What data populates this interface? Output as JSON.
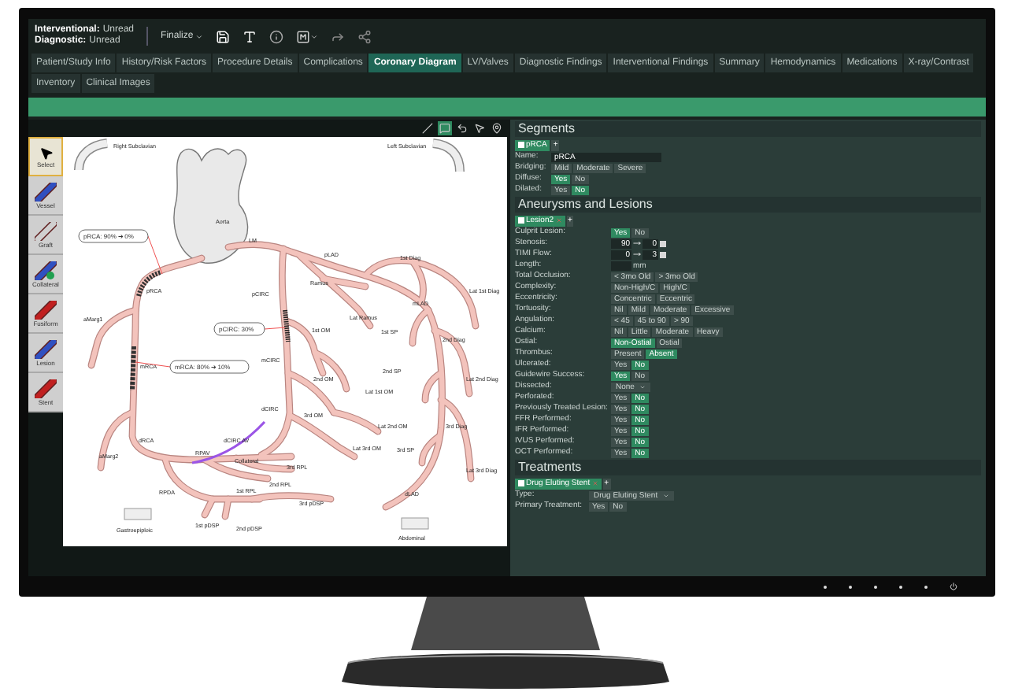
{
  "header": {
    "status": [
      {
        "label": "Interventional:",
        "value": "Unread"
      },
      {
        "label": "Diagnostic:",
        "value": "Unread"
      }
    ],
    "finalize": "Finalize"
  },
  "tabs": [
    {
      "label": "Patient/Study Info",
      "selected": false
    },
    {
      "label": "History/Risk Factors",
      "selected": false
    },
    {
      "label": "Procedure Details",
      "selected": false
    },
    {
      "label": "Complications",
      "selected": false
    },
    {
      "label": "Coronary Diagram",
      "selected": true
    },
    {
      "label": "LV/Valves",
      "selected": false
    },
    {
      "label": "Diagnostic Findings",
      "selected": false
    },
    {
      "label": "Interventional Findings",
      "selected": false
    },
    {
      "label": "Summary",
      "selected": false
    },
    {
      "label": "Hemodynamics",
      "selected": false
    },
    {
      "label": "Medications",
      "selected": false
    },
    {
      "label": "X-ray/Contrast",
      "selected": false
    },
    {
      "label": "Inventory",
      "selected": false
    },
    {
      "label": "Clinical Images",
      "selected": false
    }
  ],
  "diagram": {
    "toolbar": [
      {
        "kind": "line",
        "selected": false
      },
      {
        "kind": "comment",
        "selected": true
      },
      {
        "kind": "undo",
        "selected": false
      },
      {
        "kind": "pointer",
        "selected": false
      },
      {
        "kind": "pin",
        "selected": false
      }
    ],
    "tools": [
      {
        "label": "Select",
        "kind": "select",
        "selected": true
      },
      {
        "label": "Vessel",
        "kind": "vessel",
        "selected": false
      },
      {
        "label": "Graft",
        "kind": "graft",
        "selected": false
      },
      {
        "label": "Collateral",
        "kind": "collateral",
        "selected": false
      },
      {
        "label": "Fusiform",
        "kind": "fusiform",
        "selected": false
      },
      {
        "label": "Lesion",
        "kind": "lesion",
        "selected": false
      },
      {
        "label": "Stent",
        "kind": "stent",
        "selected": false
      }
    ],
    "labels": [
      "Right Subclavian",
      "Left Subclavian",
      "Aorta",
      "LM",
      "pLAD",
      "1st Diag",
      "Lat 1st Diag",
      "Ramus",
      "pCIRC",
      "Lat Ramus",
      "mLAD",
      "1st SP",
      "2nd Diag",
      "pRCA",
      "aMarg1",
      "1st OM",
      "mCIRC",
      "mRCA",
      "2nd OM",
      "2nd SP",
      "Lat 1st OM",
      "Lat 2nd Diag",
      "dCIRC",
      "3rd OM",
      "Lat 2nd OM",
      "3rd Diag",
      "dRCA",
      "Lat 3rd OM",
      "3rd SP",
      "Lat 3rd Diag",
      "aMarg2",
      "RPAV",
      "dCIRC AV",
      "Collateral",
      "3rd RPL",
      "2nd RPL",
      "1st RPL",
      "RPDA",
      "3rd pDSP",
      "1st pDSP",
      "2nd pDSP",
      "dLAD"
    ],
    "callouts": [
      "pRCA: 90% ➔ 0%",
      "pCIRC: 30%",
      "mRCA: 80% ➔ 10%"
    ],
    "landmarks": [
      "Gastroepiploic",
      "Abdominal"
    ]
  },
  "segments": {
    "title": "Segments",
    "chips": [
      {
        "label": "pRCA",
        "selected": true
      }
    ],
    "add": "+",
    "name": {
      "label": "Name:",
      "value": "pRCA"
    },
    "fields": [
      {
        "label": "Bridging:",
        "options": [
          {
            "label": "Mild",
            "selected": false
          },
          {
            "label": "Moderate",
            "selected": false
          },
          {
            "label": "Severe",
            "selected": false
          }
        ]
      },
      {
        "label": "Diffuse:",
        "options": [
          {
            "label": "Yes",
            "selected": true
          },
          {
            "label": "No",
            "selected": false
          }
        ]
      },
      {
        "label": "Dilated:",
        "options": [
          {
            "label": "Yes",
            "selected": false
          },
          {
            "label": "No",
            "selected": true
          }
        ]
      }
    ]
  },
  "lesions": {
    "title": "Aneurysms and Lesions",
    "chips": [
      {
        "label": "Lesion2",
        "selected": true
      }
    ],
    "add": "+",
    "fields": [
      {
        "label": "Culprit Lesion:",
        "kind": "options",
        "options": [
          {
            "label": "Yes",
            "selected": true
          },
          {
            "label": "No",
            "selected": false
          }
        ]
      },
      {
        "label": "Stenosis:",
        "kind": "range",
        "from": "90",
        "to": "0"
      },
      {
        "label": "TIMI Flow:",
        "kind": "range",
        "from": "0",
        "to": "3"
      },
      {
        "label": "Length:",
        "kind": "length",
        "unit": "mm"
      },
      {
        "label": "Total Occlusion:",
        "kind": "options",
        "options": [
          {
            "label": "< 3mo Old",
            "selected": false
          },
          {
            "label": "> 3mo Old",
            "selected": false
          }
        ]
      },
      {
        "label": "Complexity:",
        "kind": "options",
        "options": [
          {
            "label": "Non-High/C",
            "selected": false
          },
          {
            "label": "High/C",
            "selected": false
          }
        ]
      },
      {
        "label": "Eccentricity:",
        "kind": "options",
        "options": [
          {
            "label": "Concentric",
            "selected": false
          },
          {
            "label": "Eccentric",
            "selected": false
          }
        ]
      },
      {
        "label": "Tortuosity:",
        "kind": "options",
        "options": [
          {
            "label": "Nil",
            "selected": false
          },
          {
            "label": "Mild",
            "selected": false
          },
          {
            "label": "Moderate",
            "selected": false
          },
          {
            "label": "Excessive",
            "selected": false
          }
        ]
      },
      {
        "label": "Angulation:",
        "kind": "options",
        "options": [
          {
            "label": "< 45",
            "selected": false
          },
          {
            "label": "45 to 90",
            "selected": false
          },
          {
            "label": "> 90",
            "selected": false
          }
        ]
      },
      {
        "label": "Calcium:",
        "kind": "options",
        "options": [
          {
            "label": "Nil",
            "selected": false
          },
          {
            "label": "Little",
            "selected": false
          },
          {
            "label": "Moderate",
            "selected": false
          },
          {
            "label": "Heavy",
            "selected": false
          }
        ]
      },
      {
        "label": "Ostial:",
        "kind": "options",
        "options": [
          {
            "label": "Non-Ostial",
            "selected": true
          },
          {
            "label": "Ostial",
            "selected": false
          }
        ]
      },
      {
        "label": "Thrombus:",
        "kind": "options",
        "options": [
          {
            "label": "Present",
            "selected": false
          },
          {
            "label": "Absent",
            "selected": true
          }
        ]
      },
      {
        "label": "Ulcerated:",
        "kind": "options",
        "options": [
          {
            "label": "Yes",
            "selected": false
          },
          {
            "label": "No",
            "selected": true
          }
        ]
      },
      {
        "label": "Guidewire Success:",
        "kind": "options",
        "options": [
          {
            "label": "Yes",
            "selected": true
          },
          {
            "label": "No",
            "selected": false
          }
        ]
      },
      {
        "label": "Dissected:",
        "kind": "dropdown",
        "value": "None"
      },
      {
        "label": "Perforated:",
        "kind": "options",
        "options": [
          {
            "label": "Yes",
            "selected": false
          },
          {
            "label": "No",
            "selected": true
          }
        ]
      },
      {
        "label": "Previously Treated Lesion:",
        "kind": "options",
        "options": [
          {
            "label": "Yes",
            "selected": false
          },
          {
            "label": "No",
            "selected": true
          }
        ]
      },
      {
        "label": "FFR Performed:",
        "kind": "options",
        "options": [
          {
            "label": "Yes",
            "selected": false
          },
          {
            "label": "No",
            "selected": true
          }
        ]
      },
      {
        "label": "IFR Performed:",
        "kind": "options",
        "options": [
          {
            "label": "Yes",
            "selected": false
          },
          {
            "label": "No",
            "selected": true
          }
        ]
      },
      {
        "label": "IVUS Performed:",
        "kind": "options",
        "options": [
          {
            "label": "Yes",
            "selected": false
          },
          {
            "label": "No",
            "selected": true
          }
        ]
      },
      {
        "label": "OCT Performed:",
        "kind": "options",
        "options": [
          {
            "label": "Yes",
            "selected": false
          },
          {
            "label": "No",
            "selected": true
          }
        ]
      }
    ]
  },
  "treatments": {
    "title": "Treatments",
    "chips": [
      {
        "label": "Drug Eluting Stent",
        "selected": true
      }
    ],
    "add": "+",
    "fields": [
      {
        "label": "Type:",
        "kind": "dropdown",
        "value": "Drug Eluting Stent"
      },
      {
        "label": "Primary Treatment:",
        "kind": "options",
        "options": [
          {
            "label": "Yes",
            "selected": false
          },
          {
            "label": "No",
            "selected": false
          }
        ]
      }
    ]
  }
}
